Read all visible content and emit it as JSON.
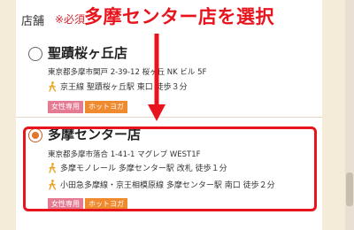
{
  "section": {
    "label": "店舗",
    "required_note": "※必須"
  },
  "callout": {
    "text": "多摩センター店を選択",
    "color": "#e8141d"
  },
  "stores": [
    {
      "name": "聖蹟桜ヶ丘店",
      "selected": false,
      "address": "東京都多摩市関戸 2-39-12 桜ヶ丘 NK ビル 5F",
      "access": [
        "京王線 聖蹟桜ヶ丘駅 東口 徒歩３分"
      ],
      "badges": [
        "女性専用",
        "ホットヨガ"
      ]
    },
    {
      "name": "多摩センター店",
      "selected": true,
      "address": "東京都多摩市落合 1-41-1 マグレブ WEST1F",
      "access": [
        "多摩モノレール 多摩センター駅 改札 徒歩１分",
        "小田急多摩線・京王相模原線 多摩センター駅 南口 徒歩２分"
      ],
      "badges": [
        "女性専用",
        "ホットヨガ"
      ]
    }
  ],
  "colors": {
    "page_bg": "#f4ecd9",
    "women_badge": "#e57a93",
    "yoga_badge": "#ef8a2e",
    "radio_selected": "#e0772b"
  },
  "icons": {
    "walk": "walking-person-icon"
  }
}
